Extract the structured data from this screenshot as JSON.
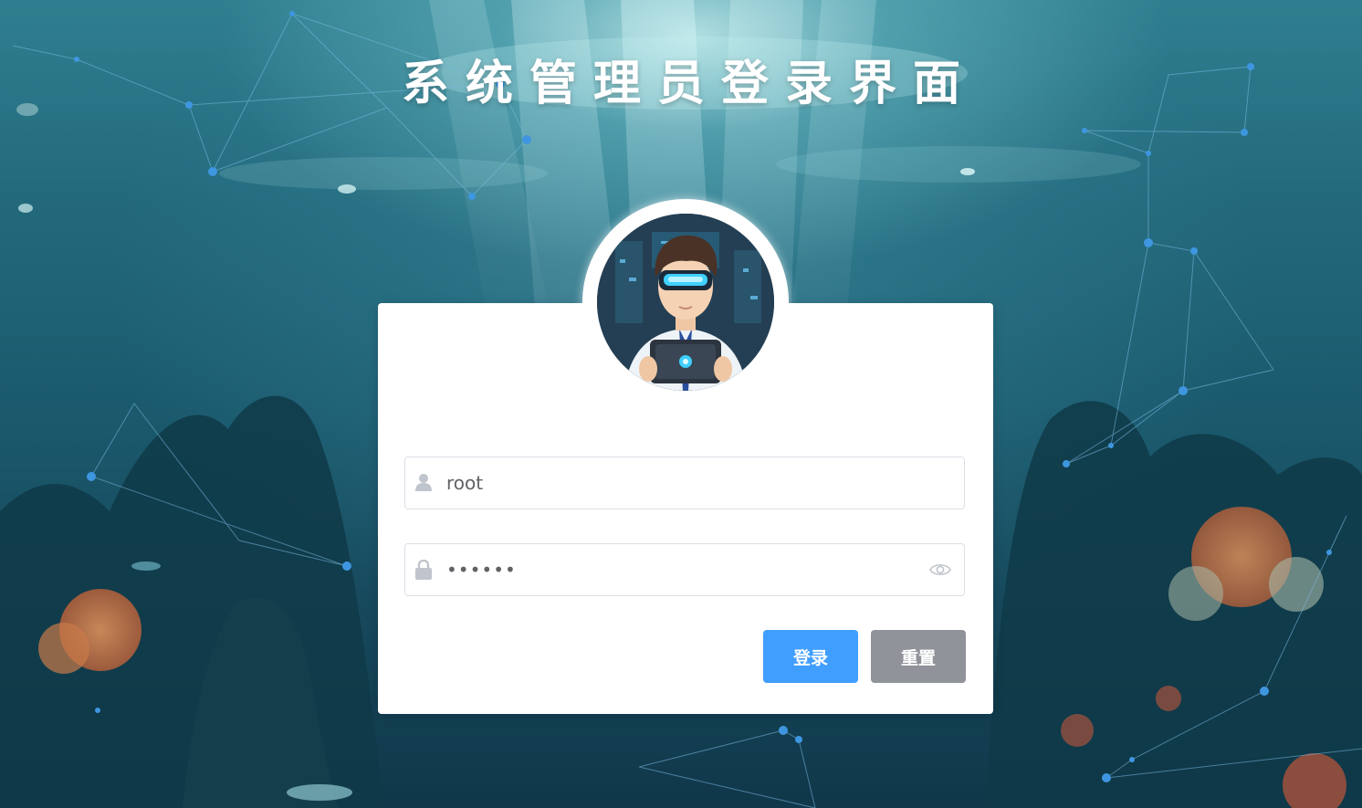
{
  "page": {
    "title": "系统管理员登录界面"
  },
  "form": {
    "username": {
      "icon": "user-icon",
      "value": "root"
    },
    "password": {
      "icon": "lock-icon",
      "value": "••••••",
      "toggle_icon": "eye-icon"
    },
    "buttons": {
      "login_label": "登录",
      "reset_label": "重置"
    }
  },
  "avatar": {
    "description_icon": "avatar-vr-icon"
  },
  "colors": {
    "primary": "#409eff",
    "secondary": "#909399",
    "border": "#dcdfe6",
    "icon": "#c0c4cc"
  }
}
